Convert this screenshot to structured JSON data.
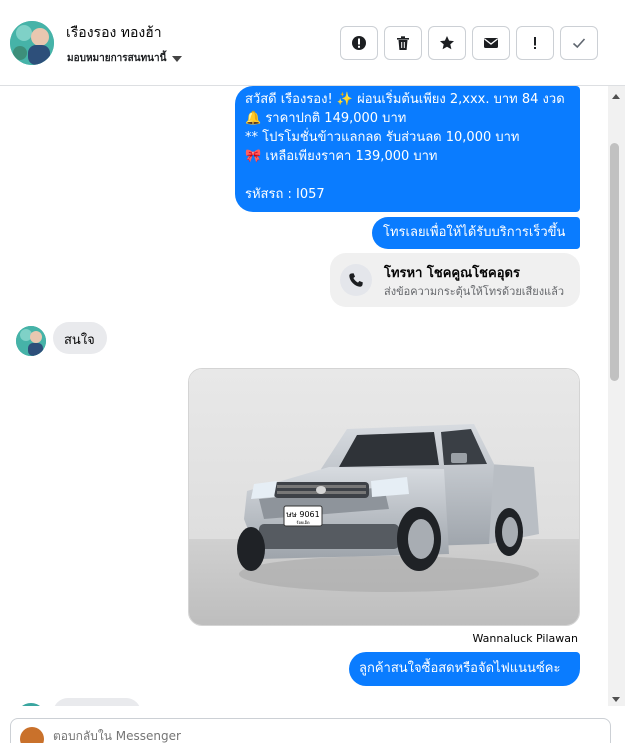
{
  "header": {
    "contact_name": "เรืองรอง ทองฮ้า",
    "assign_label": "มอบหมายการสนทนานี้",
    "actions": [
      {
        "icon": "alert-circle-icon"
      },
      {
        "icon": "trash-icon"
      },
      {
        "icon": "star-icon"
      },
      {
        "icon": "envelope-icon"
      },
      {
        "icon": "exclamation-icon"
      },
      {
        "icon": "checkmark-icon"
      }
    ]
  },
  "messages": {
    "promo_lines": [
      "สวัสดี เรืองรอง! ✨  ผ่อนเริ่มต้นเพียง 2,xxx. บาท 84 งวด",
      "🔔 ราคาปกติ 149,000 บาท",
      "** โปรโมชั่นข้าวแลกลด รับส่วนลด 10,000 บาท",
      "🎀  เหลือเพียงราคา 139,000 บาท",
      "",
      " รหัสรถ : I057"
    ],
    "call_prompt": "โทรเลยเพื่อให้ได้รับบริการเร็วขึ้น",
    "call_card": {
      "title": "โทรหา โชคคูณโชคอุดร",
      "subtitle": "ส่งข้อความกระตุ้นให้โทรด้วยเสียงแล้ว"
    },
    "incoming_interest": "สนใจ",
    "photo": {
      "plate_line1": "ษษ 9061",
      "plate_line2": "ร้อยเอ็ด"
    },
    "sender_name": "Wannaluck Pilawan",
    "reply_question": "ลูกค้าสนใจซื้อสดหรือจัดไฟแนนซ์คะ"
  },
  "composer": {
    "placeholder": "ตอบกลับใน Messenger"
  },
  "colors": {
    "outgoing_bubble": "#0a7cff",
    "incoming_bubble": "#e9eaed"
  }
}
